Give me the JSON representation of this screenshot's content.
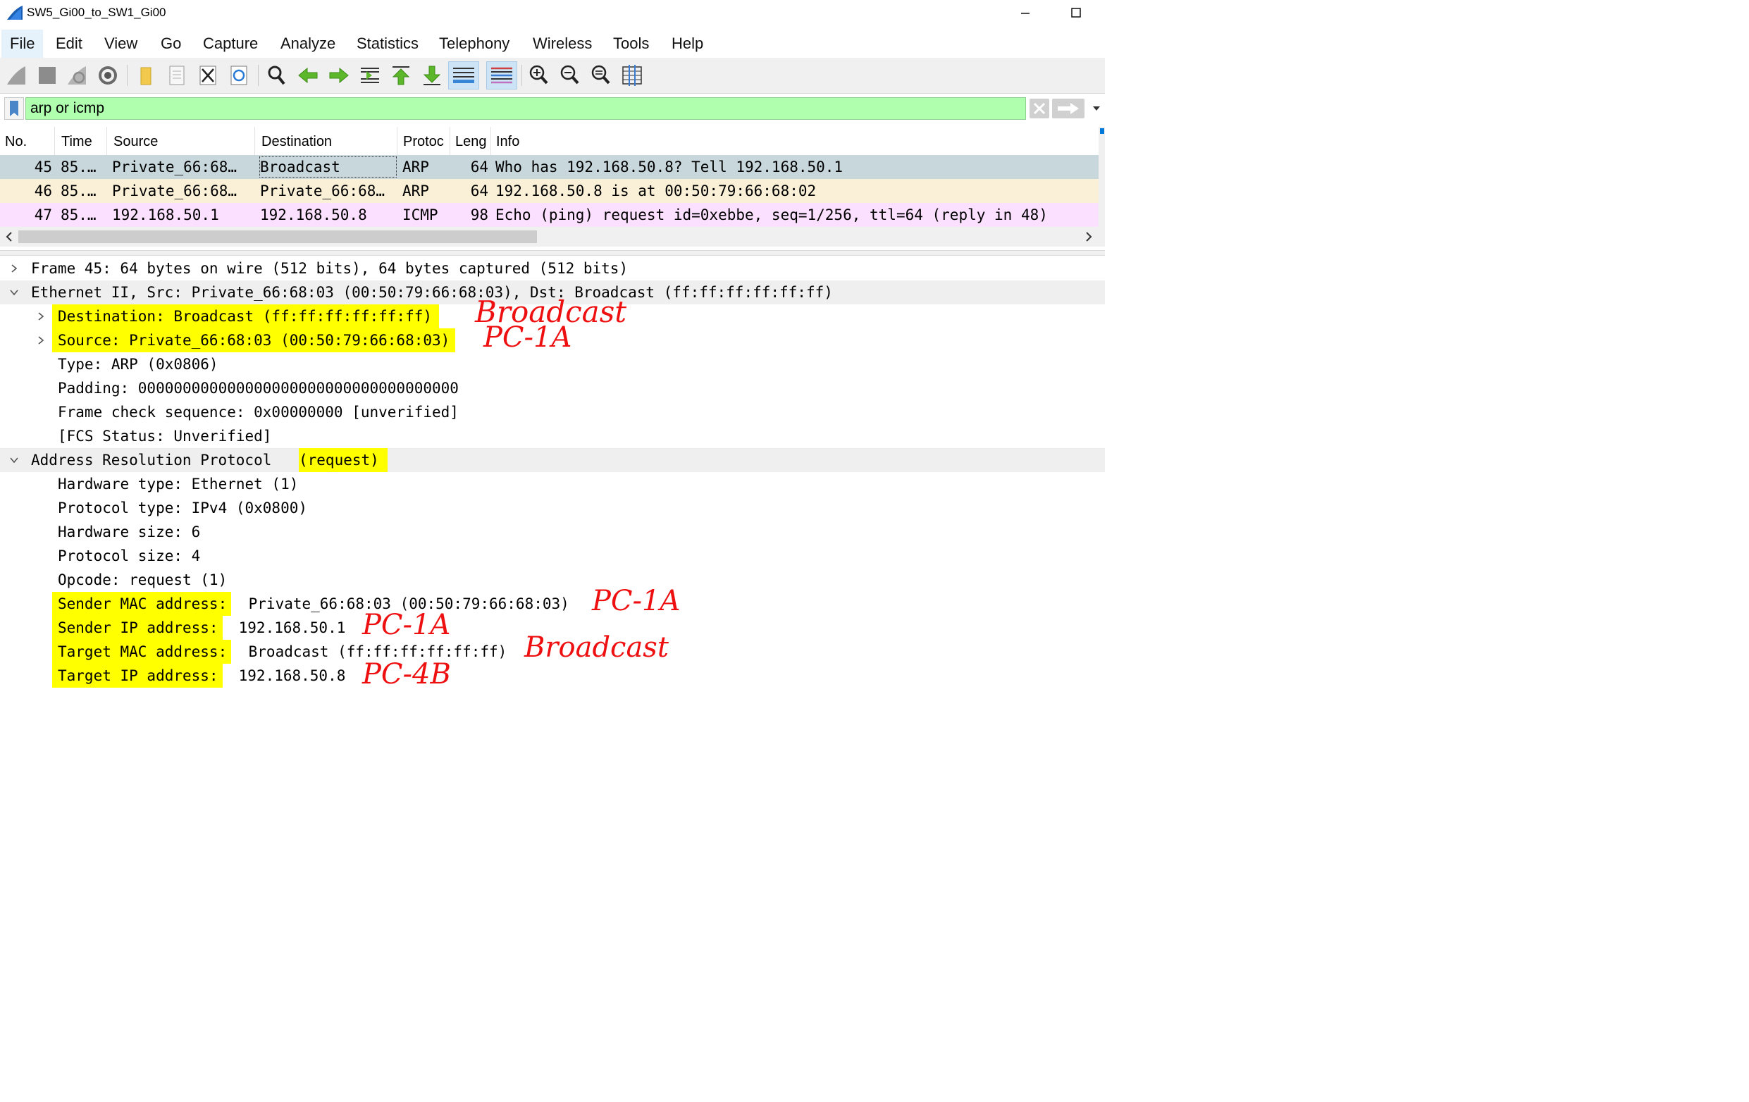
{
  "window": {
    "title": "SW5_Gi00_to_SW1_Gi00"
  },
  "menu": [
    "File",
    "Edit",
    "View",
    "Go",
    "Capture",
    "Analyze",
    "Statistics",
    "Telephony",
    "Wireless",
    "Tools",
    "Help"
  ],
  "toolbar": {
    "icons": [
      "shark-fin-start-icon",
      "stop-capture-icon",
      "restart-capture-icon",
      "capture-options-icon",
      "open-file-icon",
      "save-file-icon",
      "close-file-icon",
      "reload-file-icon",
      "find-packet-icon",
      "go-back-icon",
      "go-forward-icon",
      "go-to-packet-icon",
      "go-first-icon",
      "go-last-icon",
      "autoscroll-icon",
      "colorize-icon",
      "zoom-in-icon",
      "zoom-out-icon",
      "normal-size-icon",
      "resize-columns-icon"
    ]
  },
  "filter": {
    "value": "arp or icmp",
    "color": "#afffaf"
  },
  "packet_list": {
    "columns": [
      "No.",
      "Time",
      "Source",
      "Destination",
      "Protoc",
      "Leng",
      "Info"
    ],
    "rows": [
      {
        "no": "45",
        "time": "85.…",
        "source": "Private_66:68…",
        "destination": "Broadcast",
        "protocol": "ARP",
        "length": "64",
        "info": "Who has 192.168.50.8? Tell 192.168.50.1",
        "color": "#c8d7dc"
      },
      {
        "no": "46",
        "time": "85.…",
        "source": "Private_66:68…",
        "destination": "Private_66:68…",
        "protocol": "ARP",
        "length": "64",
        "info": "192.168.50.8 is at 00:50:79:66:68:02",
        "color": "#faf0d7"
      },
      {
        "no": "47",
        "time": "85.…",
        "source": "192.168.50.1",
        "destination": "192.168.50.8",
        "protocol": "ICMP",
        "length": "98",
        "info": "Echo (ping) request  id=0xebbe, seq=1/256, ttl=64 (reply in 48)",
        "color": "#fce0ff"
      }
    ]
  },
  "details": {
    "frame": "Frame 45: 64 bytes on wire (512 bits), 64 bytes captured (512 bits)",
    "ethernet": "Ethernet II, Src: Private_66:68:03 (00:50:79:66:68:03), Dst: Broadcast (ff:ff:ff:ff:ff:ff)",
    "eth_dst": "Destination: Broadcast (ff:ff:ff:ff:ff:ff)",
    "eth_src": "Source: Private_66:68:03 (00:50:79:66:68:03)",
    "eth_type": "Type: ARP (0x0806)",
    "eth_padding": "Padding: 000000000000000000000000000000000000",
    "eth_fcs": "Frame check sequence: 0x00000000 [unverified]",
    "eth_fcs_status": "[FCS Status: Unverified]",
    "arp_prefix": "Address Resolution Protocol ",
    "arp_suffix": "(request)",
    "hw_type": "Hardware type: Ethernet (1)",
    "proto_type": "Protocol type: IPv4 (0x0800)",
    "hw_size": "Hardware size: 6",
    "proto_size": "Protocol size: 4",
    "opcode": "Opcode: request (1)",
    "sender_mac_label": "Sender MAC address:",
    "sender_mac_value": " Private_66:68:03 (00:50:79:66:68:03)",
    "sender_ip_label": "Sender IP address:",
    "sender_ip_value": " 192.168.50.1",
    "target_mac_label": "Target MAC address:",
    "target_mac_value": " Broadcast (ff:ff:ff:ff:ff:ff)",
    "target_ip_label": "Target IP address:",
    "target_ip_value": " 192.168.50.8"
  },
  "annotations": {
    "eth_dst": "Broadcast",
    "eth_src": "PC-1A",
    "sender_mac": "PC-1A",
    "sender_ip": "PC-1A",
    "target_mac": "Broadcast",
    "target_ip": "PC-4B",
    "color": "#ee1010"
  },
  "highlight_color": "#ffff00"
}
